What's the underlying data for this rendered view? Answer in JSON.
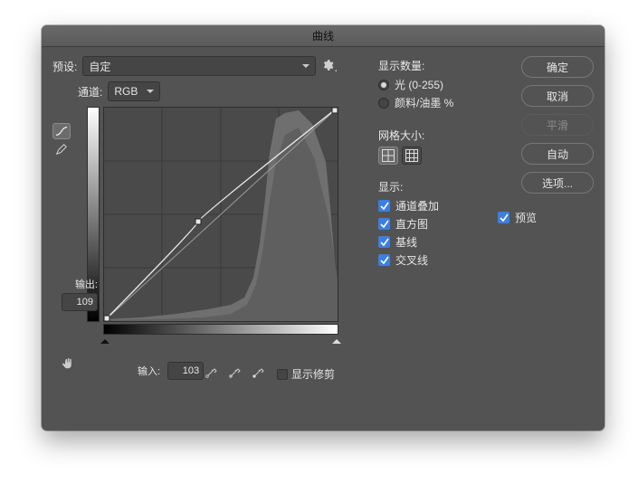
{
  "title": "曲线",
  "preset": {
    "label": "预设:",
    "value": "自定"
  },
  "channel": {
    "label": "通道:",
    "value": "RGB"
  },
  "output": {
    "label": "输出:",
    "value": "109"
  },
  "input": {
    "label": "输入:",
    "value": "103"
  },
  "clip": {
    "label": "显示修剪"
  },
  "display_amount": {
    "heading": "显示数量:",
    "light": "光 (0-255)",
    "ink": "颜料/油墨 %"
  },
  "grid": {
    "heading": "网格大小:"
  },
  "show": {
    "heading": "显示:",
    "overlay": "通道叠加",
    "histogram": "直方图",
    "baseline": "基线",
    "intersection": "交叉线"
  },
  "buttons": {
    "ok": "确定",
    "cancel": "取消",
    "smooth": "平滑",
    "auto": "自动",
    "options": "选项..."
  },
  "preview": {
    "label": "预览"
  },
  "chart_data": {
    "type": "line",
    "title": "曲线",
    "xlabel": "输入",
    "ylabel": "输出",
    "xlim": [
      0,
      255
    ],
    "ylim": [
      0,
      255
    ],
    "grid": true,
    "series": [
      {
        "name": "curve",
        "x": [
          0,
          103,
          255
        ],
        "y": [
          0,
          109,
          255
        ]
      }
    ],
    "histogram_peak_range": [
      170,
      240
    ]
  }
}
